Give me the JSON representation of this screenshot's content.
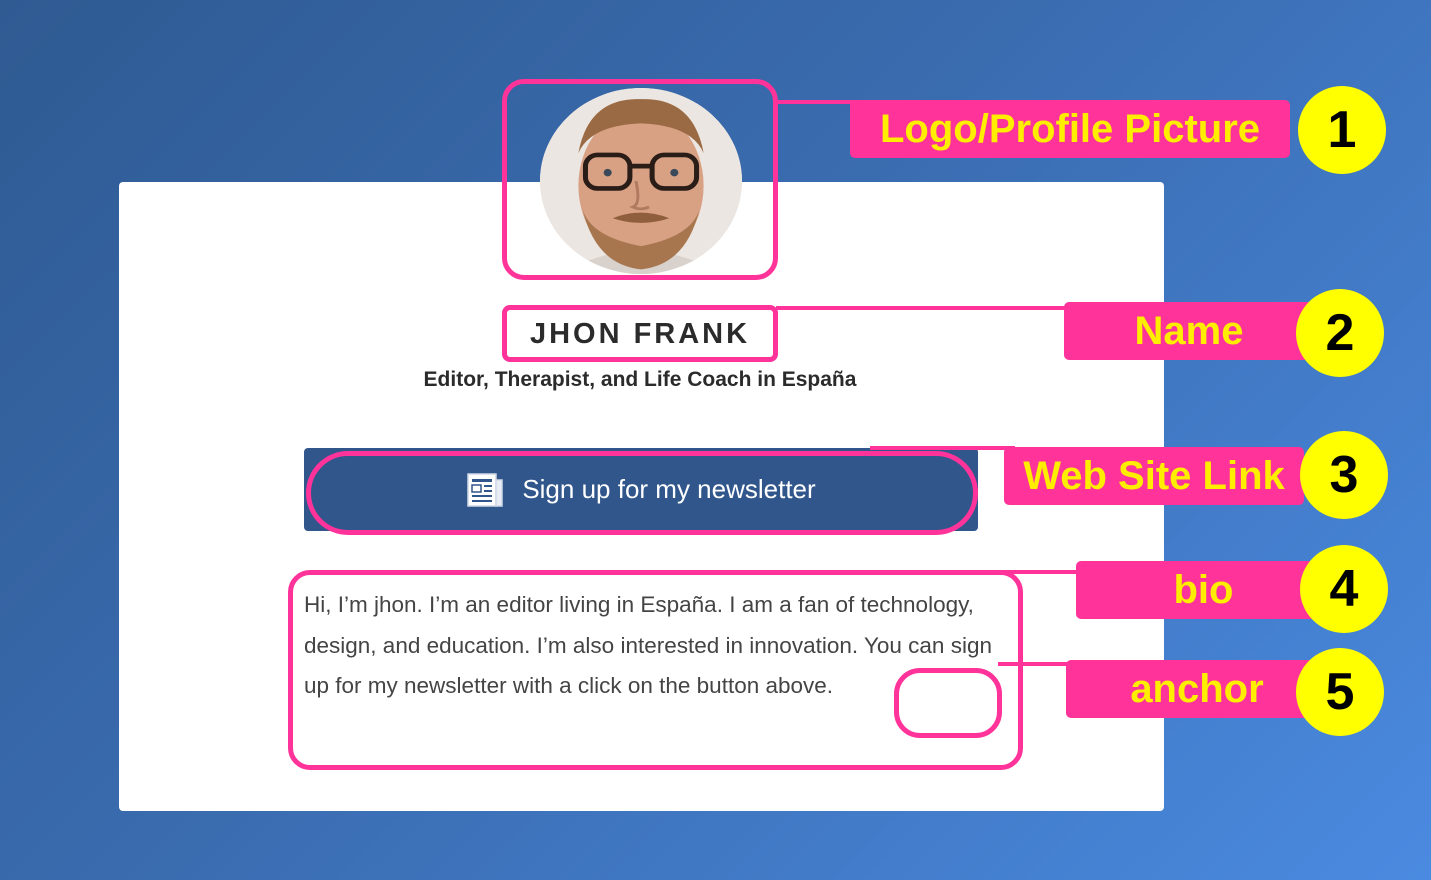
{
  "profile": {
    "name": "JHON FRANK",
    "subtitle": "Editor, Therapist, and Life Coach in España"
  },
  "newsletter_button": {
    "label": "Sign up for my newsletter",
    "icon": "newspaper-icon"
  },
  "bio": {
    "before_anchor": "Hi, I’m jhon. I’m an editor living in España. I am a fan of technology, design, and education. I’m also interested in innovation. You can sign up for my newsletter with a ",
    "anchor_text": "click",
    "after_anchor": " on the button above."
  },
  "annotations": [
    {
      "number": "1",
      "label": "Logo/Profile Picture"
    },
    {
      "number": "2",
      "label": "Name"
    },
    {
      "number": "3",
      "label": "Web Site Link"
    },
    {
      "number": "4",
      "label": "bio"
    },
    {
      "number": "5",
      "label": "anchor"
    }
  ],
  "colors": {
    "highlight": "#ff3399",
    "label_text": "#ffee00",
    "badge": "#ffff00",
    "button": "#30568c"
  }
}
